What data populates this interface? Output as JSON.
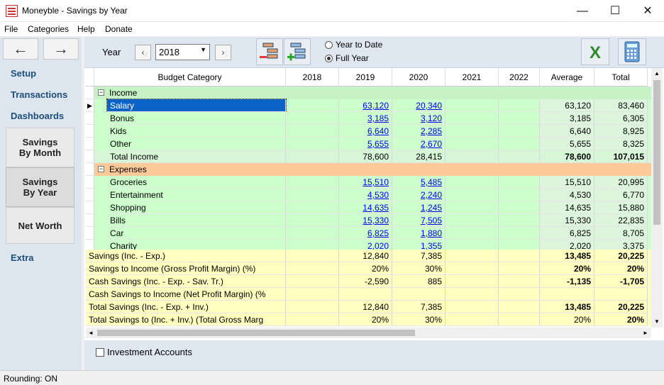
{
  "window": {
    "title": "Moneyble - Savings by Year",
    "minimize": "—",
    "maximize": "☐",
    "close": "✕"
  },
  "menu": {
    "file": "File",
    "categories": "Categories",
    "help": "Help",
    "donate": "Donate"
  },
  "sidebar": {
    "back": "←",
    "forward": "→",
    "setup": "Setup",
    "transactions": "Transactions",
    "dashboards": "Dashboards",
    "savings_by_month": "Savings By Month",
    "savings_by_year": "Savings By Year",
    "net_worth": "Net Worth",
    "extra": "Extra"
  },
  "toolbar": {
    "year_label": "Year",
    "prev": "‹",
    "next": "›",
    "year_value": "2018",
    "radio_ytd": "Year to Date",
    "radio_full": "Full Year",
    "excel_icon": "excel-icon",
    "calc_icon": "calculator-icon",
    "collapse_icon": "collapse-tree-icon",
    "expand_icon": "expand-tree-icon"
  },
  "columns": [
    "Budget Category",
    "2018",
    "2019",
    "2020",
    "2021",
    "2022",
    "Average",
    "Total"
  ],
  "income": {
    "header": "Income",
    "rows": [
      [
        "Salary",
        "",
        "63,120",
        "20,340",
        "",
        "",
        "63,120",
        "83,460"
      ],
      [
        "Bonus",
        "",
        "3,185",
        "3,120",
        "",
        "",
        "3,185",
        "6,305"
      ],
      [
        "Kids",
        "",
        "6,640",
        "2,285",
        "",
        "",
        "6,640",
        "8,925"
      ],
      [
        "Other",
        "",
        "5,655",
        "2,670",
        "",
        "",
        "5,655",
        "8,325"
      ]
    ],
    "total": [
      "Total Income",
      "",
      "78,600",
      "28,415",
      "",
      "",
      "78,600",
      "107,015"
    ]
  },
  "expenses": {
    "header": "Expenses",
    "rows": [
      [
        "Groceries",
        "",
        "15,510",
        "5,485",
        "",
        "",
        "15,510",
        "20,995"
      ],
      [
        "Entertainment",
        "",
        "4,530",
        "2,240",
        "",
        "",
        "4,530",
        "6,770"
      ],
      [
        "Shopping",
        "",
        "14,635",
        "1,245",
        "",
        "",
        "14,635",
        "15,880"
      ],
      [
        "Bills",
        "",
        "15,330",
        "7,505",
        "",
        "",
        "15,330",
        "22,835"
      ],
      [
        "Car",
        "",
        "6,825",
        "1,880",
        "",
        "",
        "6,825",
        "8,705"
      ],
      [
        "Charity",
        "",
        "2,020",
        "1,355",
        "",
        "",
        "2,020",
        "3,375"
      ]
    ]
  },
  "summary": [
    [
      "Savings (Inc. - Exp.)",
      "",
      "12,840",
      "7,385",
      "",
      "",
      "13,485",
      "20,225"
    ],
    [
      "Savings to Income (Gross Profit Margin) (%)",
      "",
      "20%",
      "30%",
      "",
      "",
      "20%",
      "20%"
    ],
    [
      "Cash Savings (Inc. - Exp. - Sav. Tr.)",
      "",
      "-2,590",
      "885",
      "",
      "",
      "-1,135",
      "-1,705"
    ],
    [
      "Cash Savings to Income (Net Profit Margin) (%",
      "",
      "",
      "",
      "",
      "",
      "",
      ""
    ],
    [
      "Total Savings (Inc. - Exp. + Inv.)",
      "",
      "12,840",
      "7,385",
      "",
      "",
      "13,485",
      "20,225"
    ],
    [
      "Total Savings to (Inc. + Inv.) (Total Gross Marg",
      "",
      "20%",
      "30%",
      "",
      "",
      "20%",
      "20%"
    ]
  ],
  "investment_accounts": "Investment Accounts",
  "status": "Rounding: ON",
  "colors": {
    "income_bg": "#ccffcc",
    "income_header": "#c6f2c6",
    "expense_header": "#fcc998",
    "summary_bg": "#ffffc0",
    "selected": "#0a64c8"
  }
}
